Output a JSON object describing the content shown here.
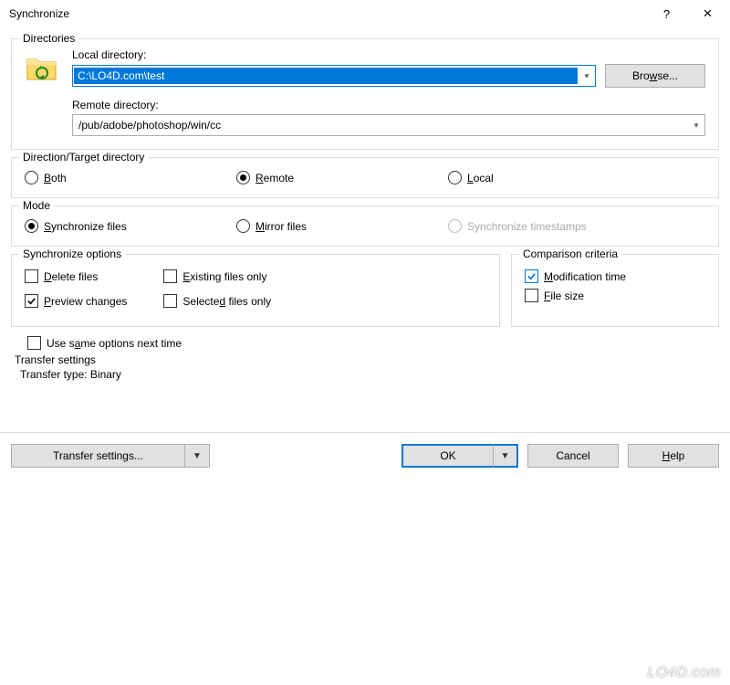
{
  "window": {
    "title": "Synchronize",
    "help": "?",
    "close": "×"
  },
  "directories": {
    "legend": "Directories",
    "local_label": "Local directory:",
    "local_value": "C:\\LO4D.com\\test",
    "browse": "Browse...",
    "remote_label": "Remote directory:",
    "remote_value": "/pub/adobe/photoshop/win/cc"
  },
  "direction": {
    "legend": "Direction/Target directory",
    "both": "Both",
    "remote": "Remote",
    "local": "Local",
    "selected": "remote"
  },
  "mode": {
    "legend": "Mode",
    "sync": "Synchronize files",
    "mirror": "Mirror files",
    "timestamps": "Synchronize timestamps",
    "selected": "sync"
  },
  "sync_options": {
    "legend": "Synchronize options",
    "delete": "Delete files",
    "preview": "Preview changes",
    "existing": "Existing files only",
    "selected_only": "Selected files only",
    "checked": [
      "preview"
    ]
  },
  "comparison": {
    "legend": "Comparison criteria",
    "mtime": "Modification time",
    "fsize": "File size",
    "checked": [
      "mtime"
    ]
  },
  "same_options": {
    "label": "Use same options next time"
  },
  "transfer": {
    "heading": "Transfer settings",
    "line": "Transfer type: Binary"
  },
  "buttons": {
    "transfer_settings": "Transfer settings...",
    "ok": "OK",
    "cancel": "Cancel",
    "help": "Help"
  },
  "underlines": {
    "both": "B",
    "remote": "R",
    "local": "L",
    "sync": "S",
    "mirror": "M",
    "delete": "D",
    "preview": "P",
    "existing": "E",
    "selected": "d",
    "mtime": "M",
    "fsize": "F",
    "same": "a",
    "browse": "w",
    "help": "H"
  },
  "watermark": "LO4D.com"
}
